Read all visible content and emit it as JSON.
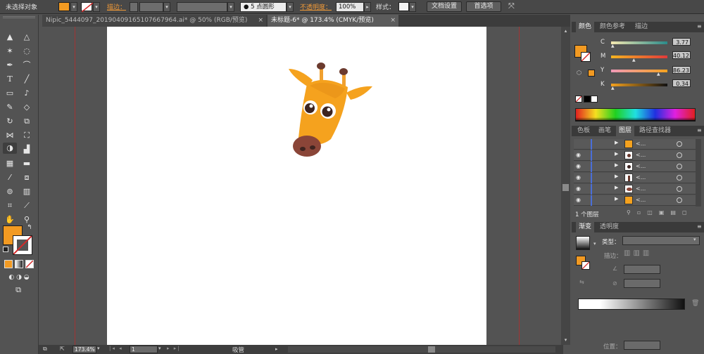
{
  "control_bar": {
    "selection_status": "未选择对象",
    "stroke_label": "描边：",
    "brush_label": "5 点圆形",
    "opacity_label": "不透明度：",
    "opacity_value": "100%",
    "style_label": "样式：",
    "doc_setup_button": "文档设置",
    "prefs_button": "首选项"
  },
  "tabs": [
    {
      "label": "Nipic_5444097_20190409165107667964.ai* @ 50% (RGB/预览)",
      "close": "×"
    },
    {
      "label": "未标题-6* @ 173.4% (CMYK/预览)",
      "close": "×"
    }
  ],
  "color_panel": {
    "tabs": [
      "颜色",
      "颜色参考",
      "描边"
    ],
    "channels": [
      {
        "name": "C",
        "value": "3.77"
      },
      {
        "name": "M",
        "value": "40.12"
      },
      {
        "name": "Y",
        "value": "86.23"
      },
      {
        "name": "K",
        "value": "0.34"
      }
    ]
  },
  "layers_panel": {
    "tabs": [
      "色板",
      "画笔",
      "图层",
      "路径查找器"
    ],
    "row_label": "<...",
    "footer": "1 个图层"
  },
  "gradient_panel": {
    "tabs": [
      "渐变",
      "透明度"
    ],
    "type_label": "类型：",
    "stroke_label": "描边：",
    "position_label": "位置："
  },
  "status_bar": {
    "zoom": "173.4%",
    "page": "1",
    "tool_name": "吸管"
  },
  "colors": {
    "fill": "#f29a22",
    "giraffe_orange": "#f5a21e",
    "horn": "#6b3a2e",
    "snout": "#8a4538"
  }
}
